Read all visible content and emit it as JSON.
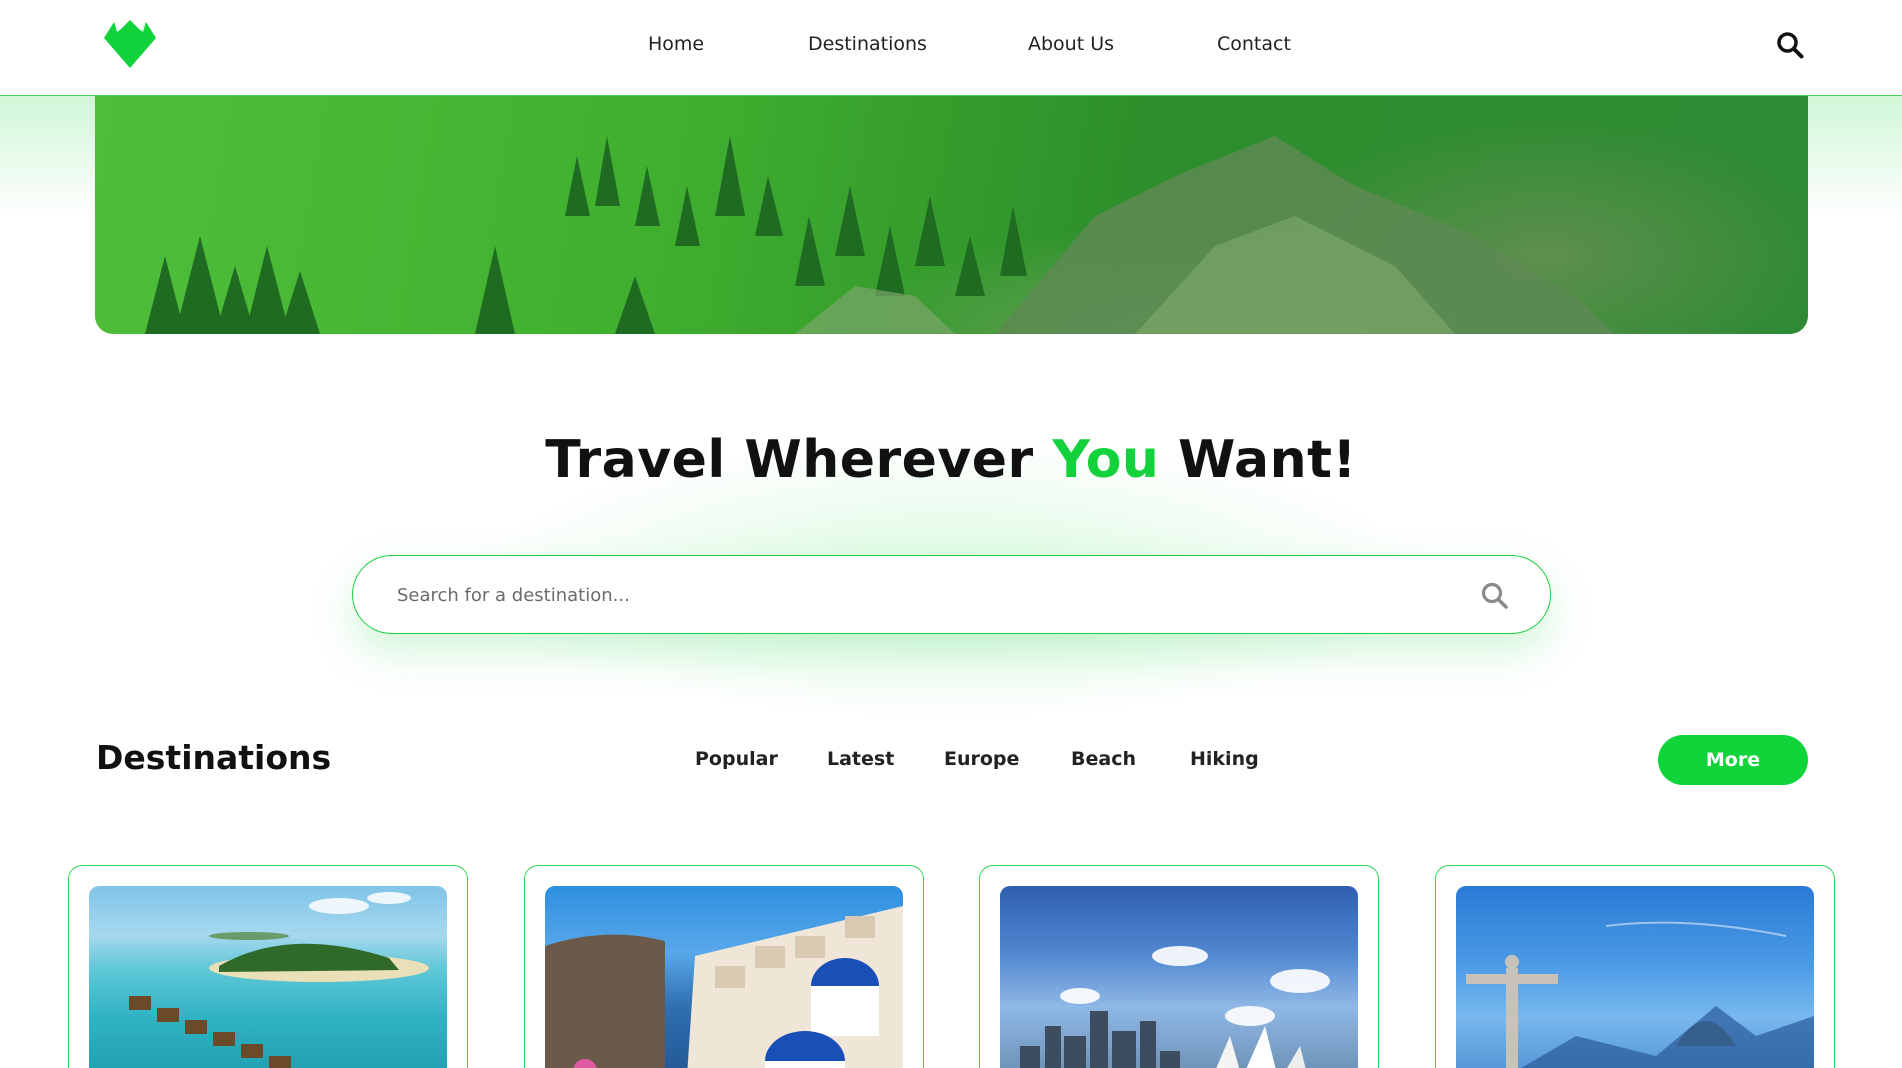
{
  "header": {
    "nav": [
      "Home",
      "Destinations",
      "About Us",
      "Contact"
    ]
  },
  "hero": {
    "title_part1": "Travel Wherever ",
    "title_accent": "You",
    "title_part2": " Want!"
  },
  "search": {
    "placeholder": "Search for a destination..."
  },
  "destinations": {
    "heading": "Destinations",
    "filters": [
      "Popular",
      "Latest",
      "Europe",
      "Beach",
      "Hiking"
    ],
    "more_label": "More"
  },
  "colors": {
    "accent": "#0fd43a",
    "border": "#2fd44f",
    "text": "#111111"
  },
  "icons": {
    "logo": "green-heart-mountain-logo",
    "search": "search-icon"
  }
}
